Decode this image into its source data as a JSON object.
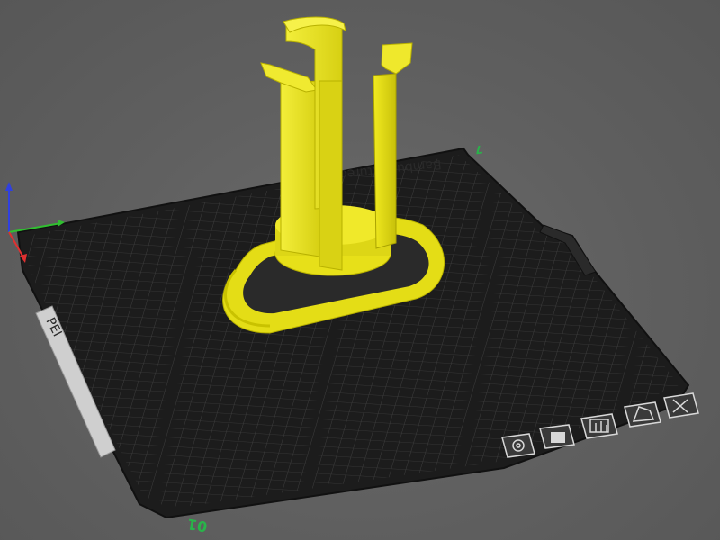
{
  "viewport": {
    "background": "#5f5f5f",
    "bed_color": "#1f1f1f",
    "bed_grid_color": "#4a4a4a",
    "model_color": "#f0ea1c",
    "axis_colors": {
      "x": "#e03030",
      "y": "#30c030",
      "z": "#3040e0"
    }
  },
  "bed": {
    "brand_text": "Bambu Textured Plate",
    "plate_number": "01",
    "corner_number": "7",
    "side_label": "PEI"
  },
  "plate_toolbar": {
    "buttons": [
      {
        "name": "plate-settings",
        "icon": "gear-icon"
      },
      {
        "name": "lock-plate",
        "icon": "lock-icon"
      },
      {
        "name": "arrange-plate",
        "icon": "arrange-icon"
      },
      {
        "name": "auto-orient",
        "icon": "orient-icon"
      },
      {
        "name": "delete-plate",
        "icon": "close-icon"
      }
    ]
  },
  "model": {
    "object": "hanger-stand"
  }
}
